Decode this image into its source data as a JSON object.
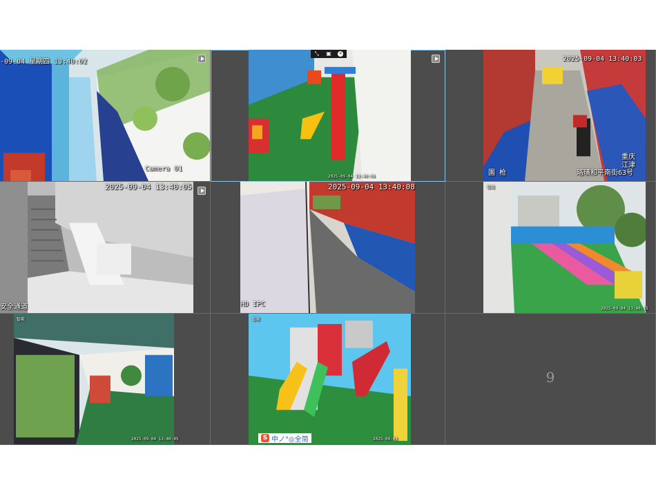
{
  "cameras": [
    {
      "slot": 1,
      "timestamp": "-09-04",
      "channel": "星期四 13:40:02",
      "label": "Camera 01"
    },
    {
      "slot": 2,
      "timestamp": "2025-09-04 13:40:08",
      "toolbar": [
        "capture-icon",
        "record-icon",
        "close-icon"
      ],
      "selected": true
    },
    {
      "slot": 3,
      "timestamp": "2025-09-04 13:40:03",
      "location_line1": "重庆",
      "location_line2": "江津",
      "address": "珞璜和平南街63号",
      "label": "園 枪"
    },
    {
      "slot": 4,
      "timestamp": "2025-09-04 13:40:05",
      "label": "安全通道"
    },
    {
      "slot": 5,
      "timestamp": "2025-09-04 13:40:08",
      "label": "HD IPC"
    },
    {
      "slot": 6,
      "timestamp": "2025-09-04 13:40:15",
      "tag": "智能"
    },
    {
      "slot": 7,
      "timestamp": "2025-09-04 13:40:05",
      "tag": "智能"
    },
    {
      "slot": 8,
      "timestamp": "2025-09-04",
      "tag": "智能",
      "brand": "中ノ°◎全简"
    },
    {
      "slot": 9,
      "empty": true,
      "number": "9"
    }
  ],
  "icons": {
    "play": "play-icon"
  }
}
